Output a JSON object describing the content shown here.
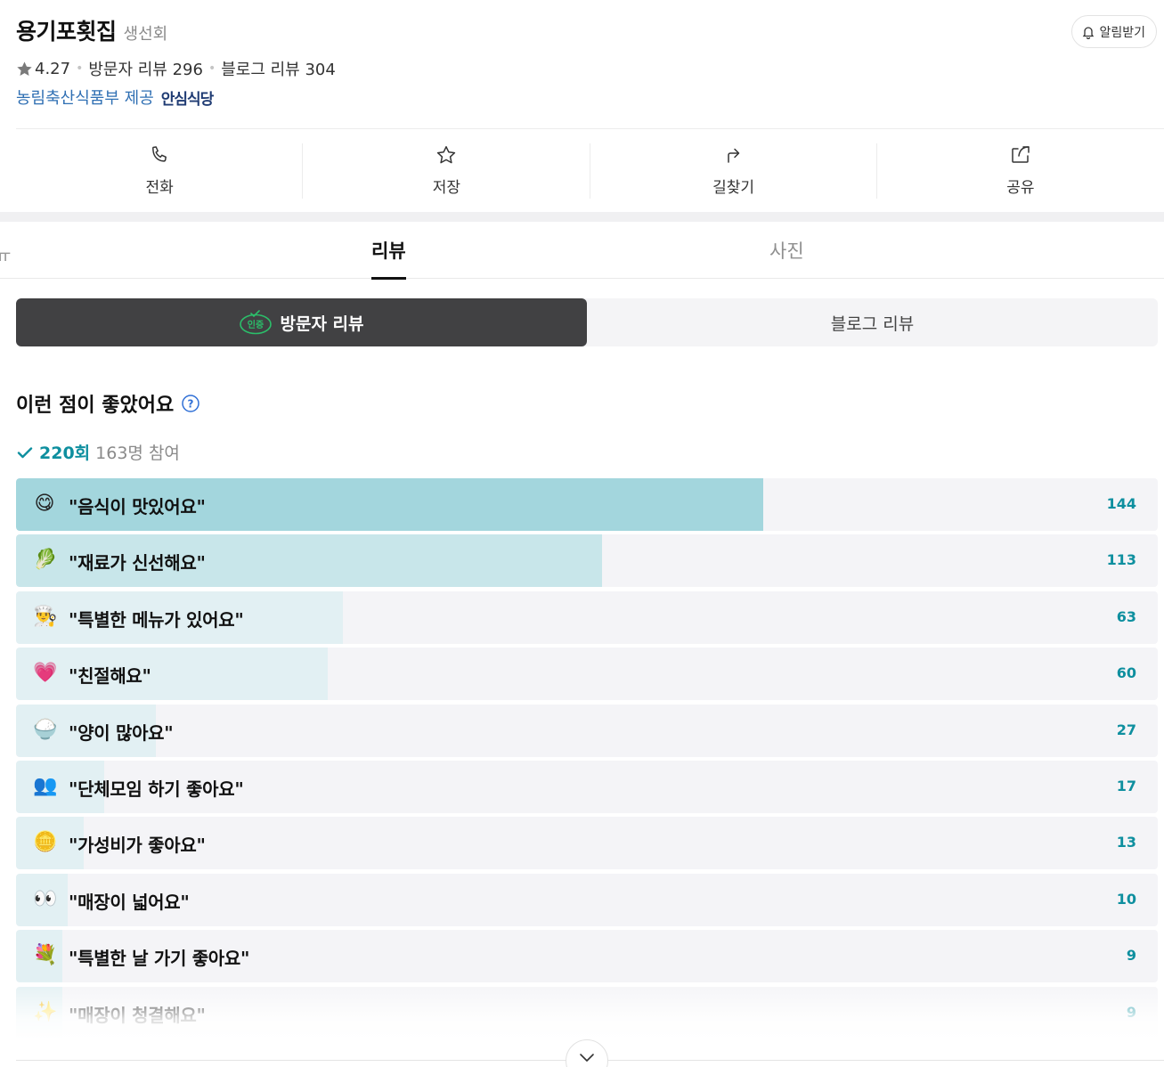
{
  "header": {
    "name": "용기포횟집",
    "category": "생선회",
    "alarm_label": "알림받기",
    "rating": "4.27",
    "visitor_reviews": "방문자 리뷰 296",
    "blog_reviews": "블로그 리뷰 304",
    "cert_text": "농림축산식품부 제공",
    "cert_badge": "안심식당"
  },
  "actions": [
    {
      "label": "전화",
      "icon": "phone-icon"
    },
    {
      "label": "저장",
      "icon": "star-outline-icon"
    },
    {
      "label": "길찾기",
      "icon": "direction-arrow-icon"
    },
    {
      "label": "공유",
      "icon": "share-icon"
    }
  ],
  "tabs": {
    "cut": "ㅠ",
    "review": "리뷰",
    "photo": "사진"
  },
  "segment": {
    "visitor": "방문자 리뷰",
    "blog": "블로그 리뷰"
  },
  "section": {
    "title": "이런 점이 좋았어요",
    "count": "220회",
    "participants": "163명 참여"
  },
  "colors": {
    "accent": "#0e8f9f",
    "bar_top1": "#a3d6dd",
    "bar_top2": "#c8e6ea",
    "bar_rest": "#e2f0f3",
    "bar_track": "#f4f4f7"
  },
  "keywords": [
    {
      "label": "\"음식이 맛있어요\"",
      "count": 144,
      "emoji": "😋",
      "icon": "yummy-face-icon"
    },
    {
      "label": "\"재료가 신선해요\"",
      "count": 113,
      "emoji": "🥬",
      "icon": "leaf-icon"
    },
    {
      "label": "\"특별한 메뉴가 있어요\"",
      "count": 63,
      "emoji": "👨‍🍳",
      "icon": "chef-icon"
    },
    {
      "label": "\"친절해요\"",
      "count": 60,
      "emoji": "💗",
      "icon": "heart-icon"
    },
    {
      "label": "\"양이 많아요\"",
      "count": 27,
      "emoji": "🍚",
      "icon": "rice-bowl-icon"
    },
    {
      "label": "\"단체모임 하기 좋아요\"",
      "count": 17,
      "emoji": "👥",
      "icon": "group-icon"
    },
    {
      "label": "\"가성비가 좋아요\"",
      "count": 13,
      "emoji": "🪙",
      "icon": "coin-icon"
    },
    {
      "label": "\"매장이 넓어요\"",
      "count": 10,
      "emoji": "👀",
      "icon": "eyes-icon"
    },
    {
      "label": "\"특별한 날 가기 좋아요\"",
      "count": 9,
      "emoji": "💐",
      "icon": "bouquet-icon"
    },
    {
      "label": "\"매장이 청결해요\"",
      "count": 9,
      "emoji": "✨",
      "icon": "sparkle-icon"
    }
  ]
}
